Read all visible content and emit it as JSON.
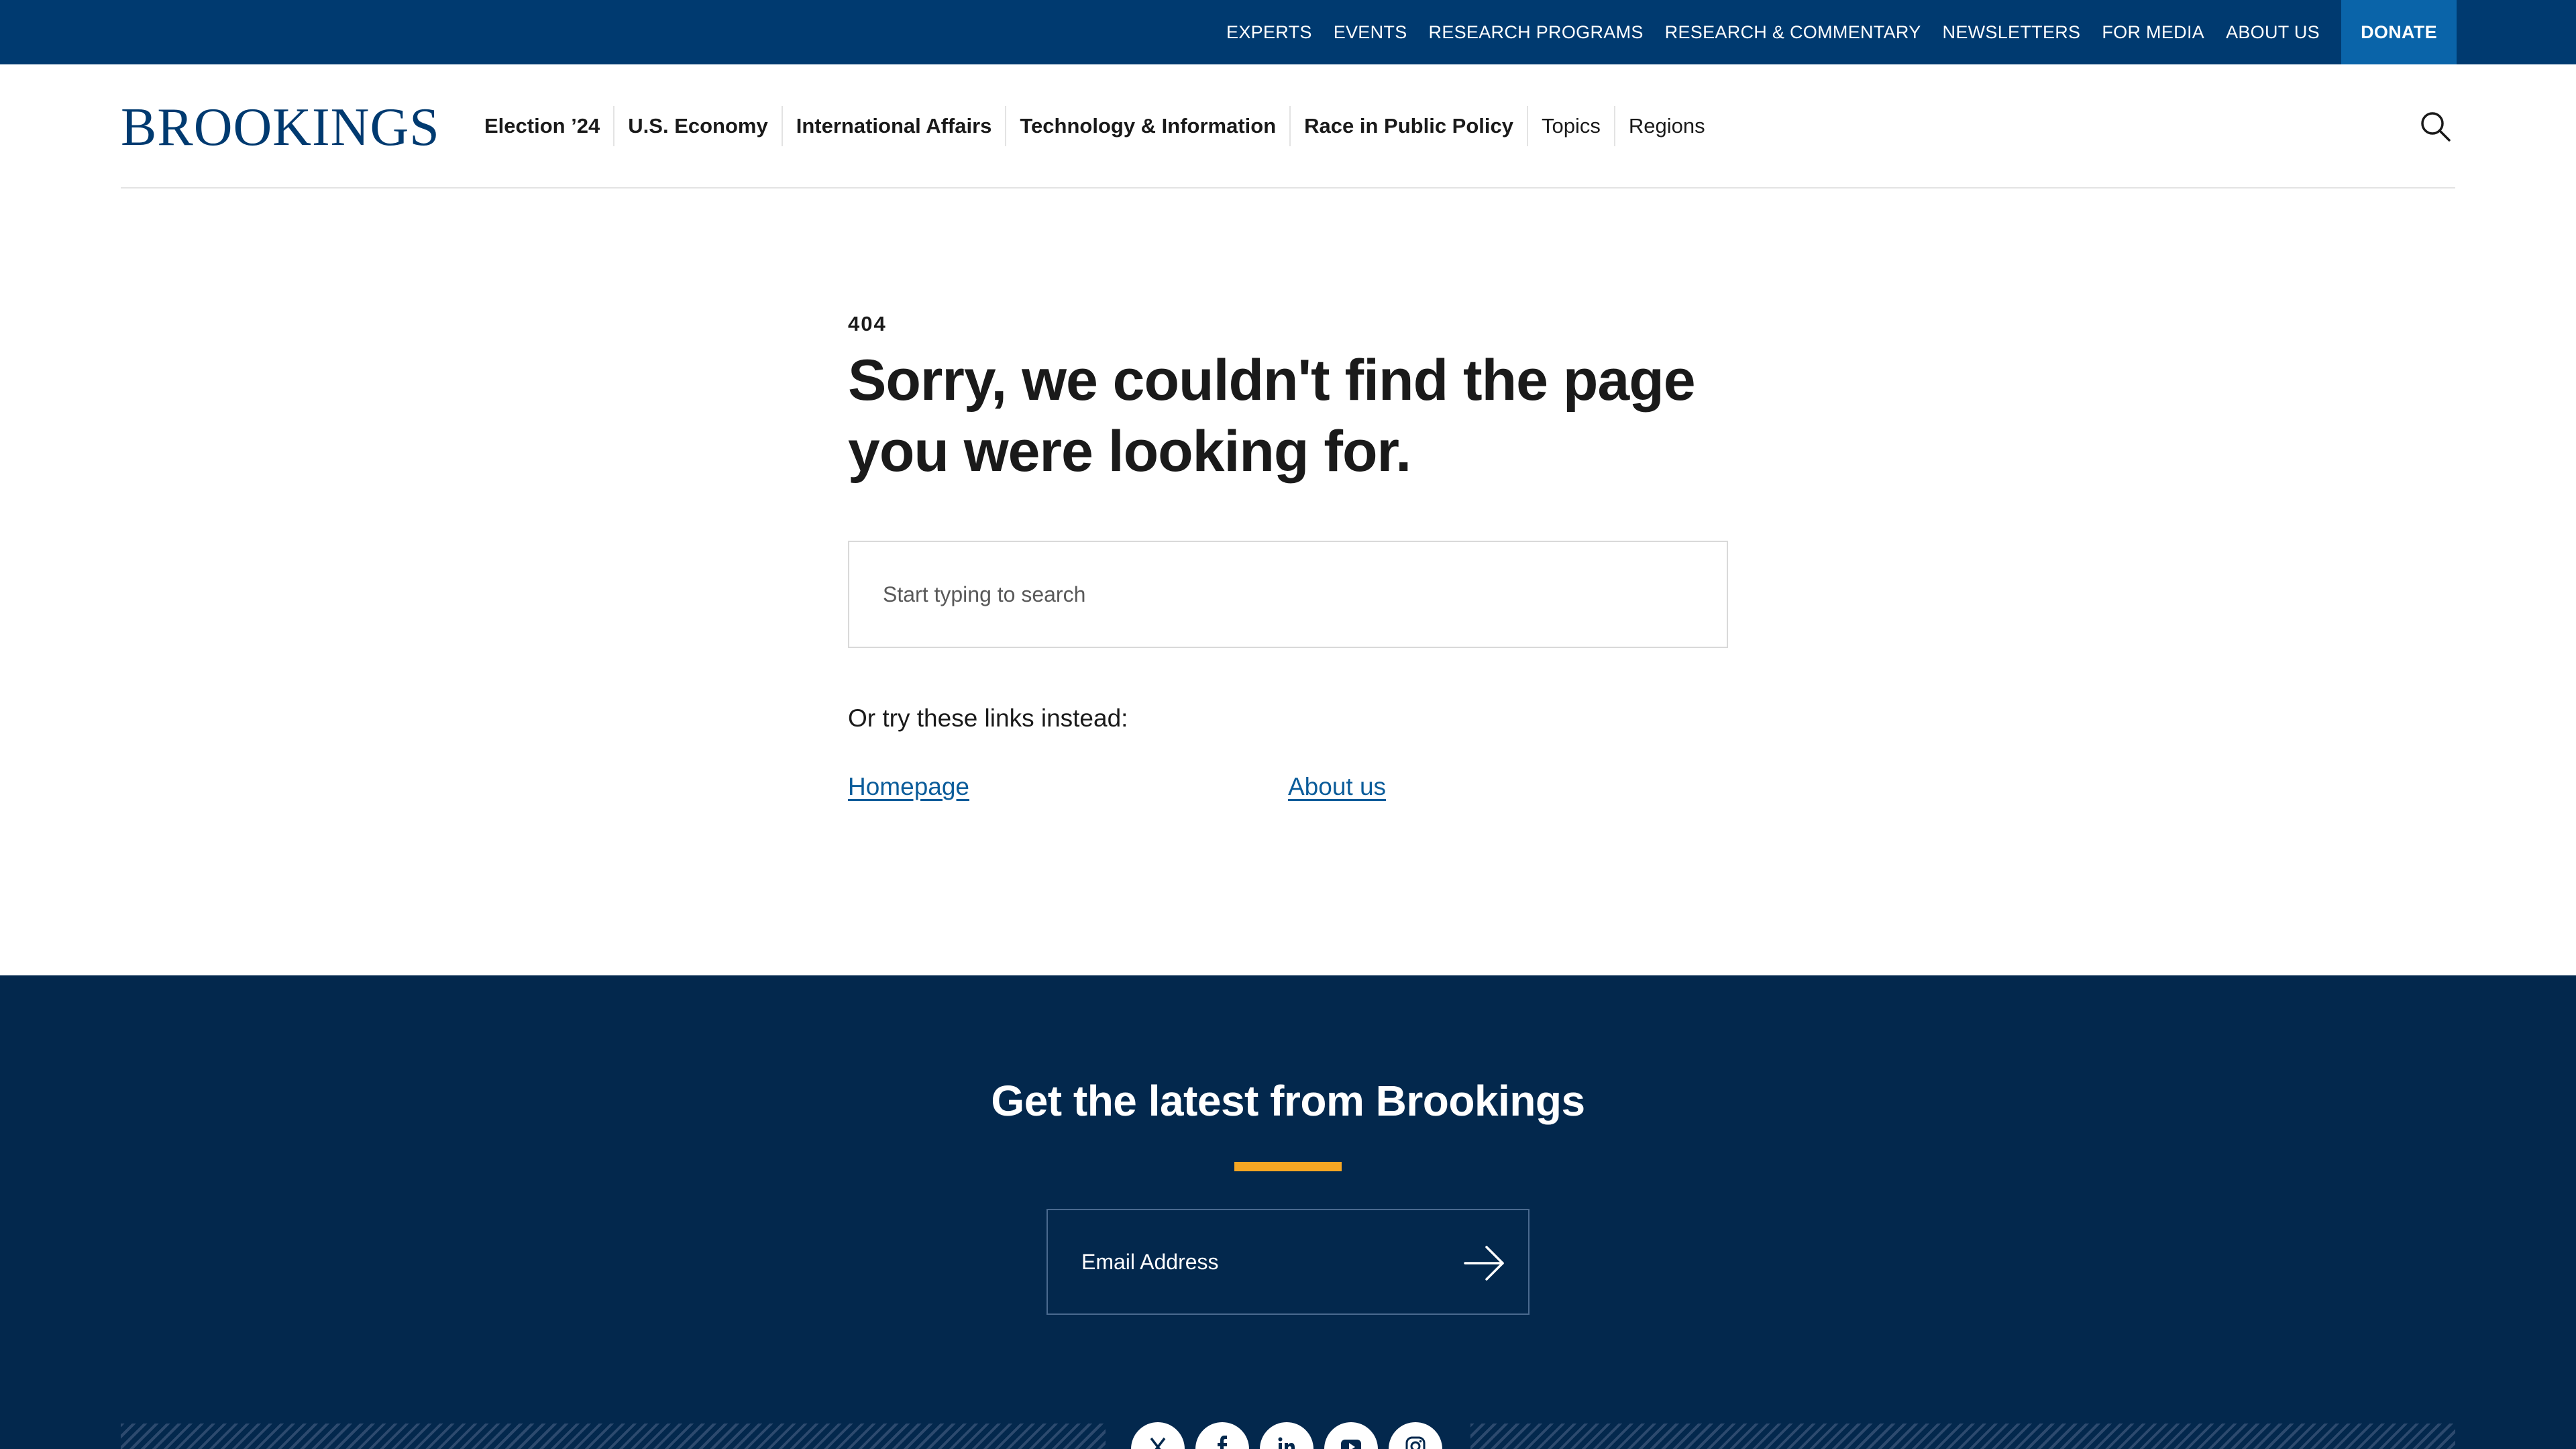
{
  "utility_nav": {
    "links": [
      "EXPERTS",
      "EVENTS",
      "RESEARCH PROGRAMS",
      "RESEARCH & COMMENTARY",
      "NEWSLETTERS",
      "FOR MEDIA",
      "ABOUT US"
    ],
    "donate_label": "DONATE"
  },
  "header": {
    "logo_text": "BROOKINGS",
    "nav": [
      "Election ’24",
      "U.S. Economy",
      "International Affairs",
      "Technology & Information",
      "Race in Public Policy",
      "Topics",
      "Regions"
    ]
  },
  "error": {
    "code": "404",
    "headline": "Sorry, we couldn't find the page you were looking for.",
    "search_placeholder": "Start typing to search",
    "alt_text": "Or try these links instead:",
    "links": [
      "Homepage",
      "About us"
    ]
  },
  "footer": {
    "title": "Get the latest from Brookings",
    "email_placeholder": "Email Address",
    "socials": [
      "x-icon",
      "facebook-icon",
      "linkedin-icon",
      "youtube-icon",
      "instagram-icon"
    ]
  },
  "colors": {
    "utility_bar": "#003a70",
    "donate": "#0a64a9",
    "footer": "#03284d",
    "accent": "#f5a623",
    "link": "#0b5c9a"
  }
}
